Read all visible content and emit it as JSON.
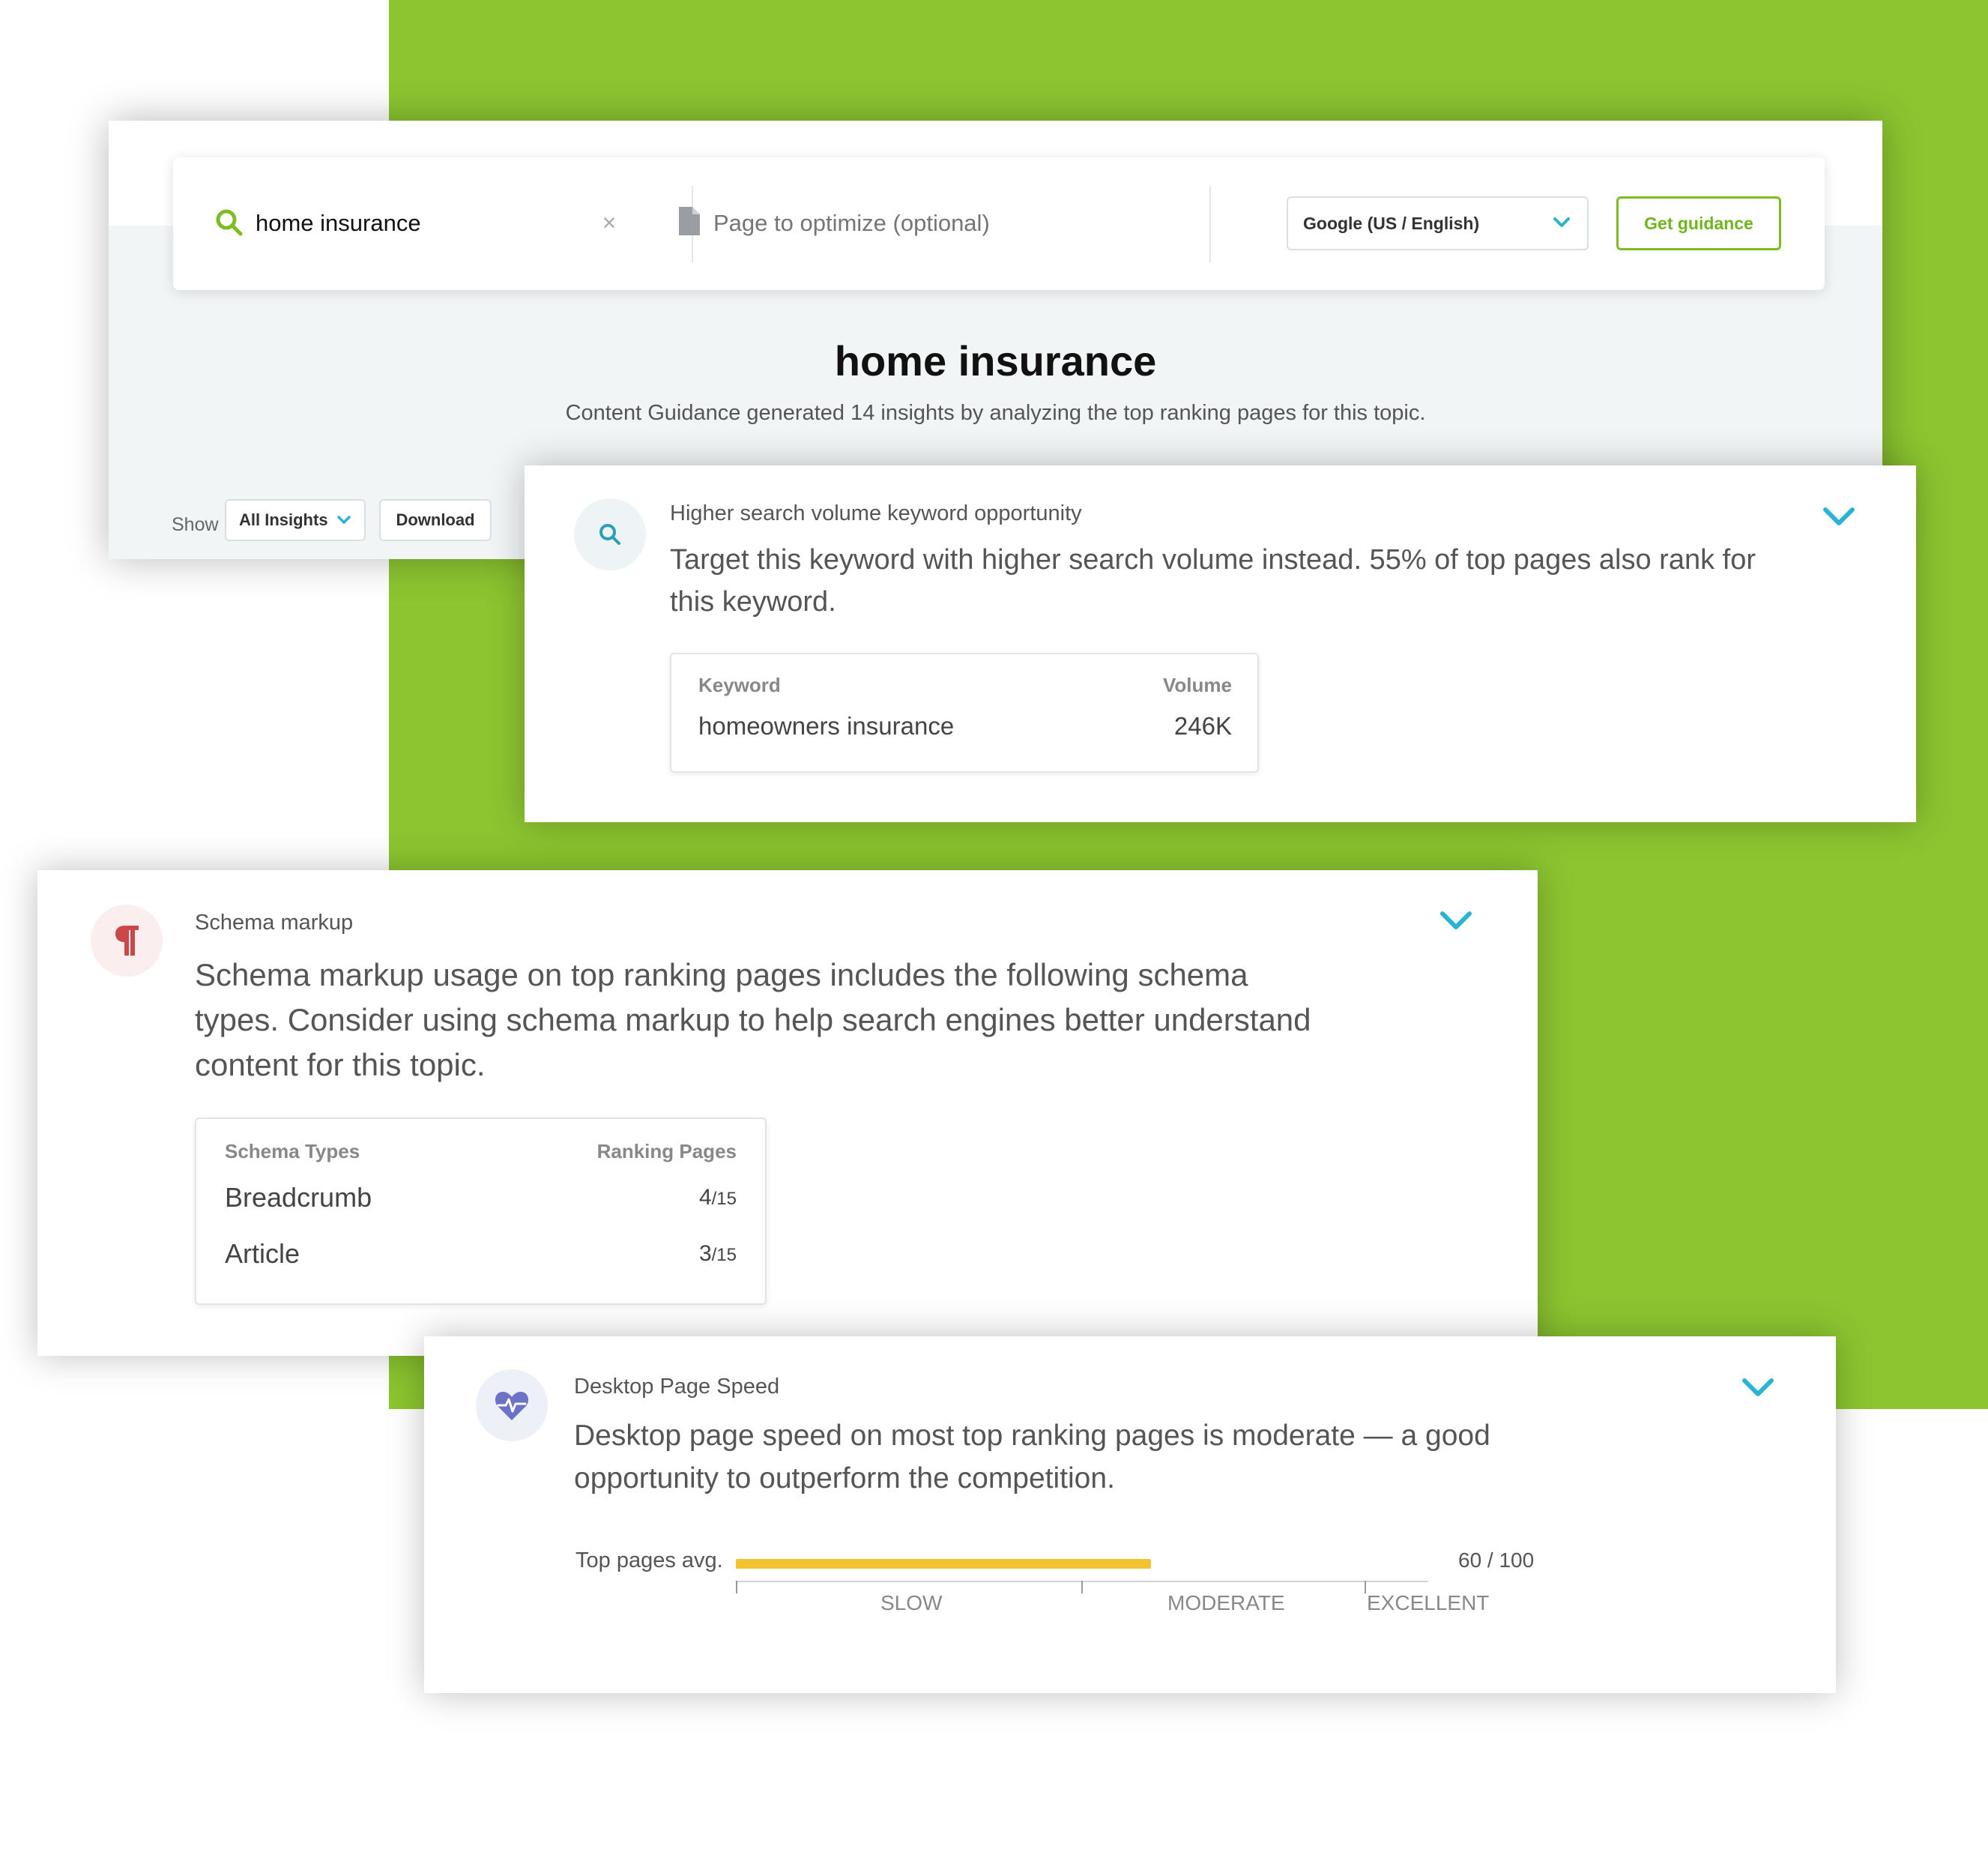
{
  "search": {
    "keyword": "home insurance",
    "page_placeholder": "Page to optimize (optional)",
    "clear_symbol": "×",
    "engine": "Google (US / English)",
    "submit_label": "Get guidance"
  },
  "topic": {
    "title": "home insurance",
    "subtitle": "Content Guidance generated 14 insights by analyzing the top ranking pages for this topic."
  },
  "toolbar": {
    "show_label": "Show",
    "filter_value": "All Insights",
    "download_label": "Download"
  },
  "insights": [
    {
      "category": "Higher search volume keyword opportunity",
      "description_lines": [
        "Target this keyword with higher search volume instead. 55% of top pages also rank for",
        "this keyword."
      ],
      "table": {
        "columns": [
          "Keyword",
          "Volume"
        ],
        "rows": [
          [
            "homeowners insurance",
            "246K"
          ]
        ]
      },
      "icon": "search-icon"
    },
    {
      "category": "Schema markup",
      "description_lines": [
        "Schema markup usage on top ranking pages includes the following schema",
        "types. Consider using schema markup to help search engines better understand",
        "content for this topic."
      ],
      "table": {
        "columns": [
          "Schema Types",
          "Ranking Pages"
        ],
        "rows": [
          {
            "type": "Breadcrumb",
            "count": "4",
            "total": "/15"
          },
          {
            "type": "Article",
            "count": "3",
            "total": "/15"
          }
        ]
      },
      "icon": "paragraph-icon"
    },
    {
      "category": "Desktop Page Speed",
      "description_lines": [
        "Desktop page speed on most top ranking pages is moderate — a good",
        "opportunity to outperform the competition."
      ],
      "speed": {
        "label": "Top pages avg.",
        "score": 60,
        "score_text": "60 / 100",
        "scale": [
          "SLOW",
          "MODERATE",
          "EXCELLENT"
        ]
      },
      "icon": "heartbeat-icon"
    }
  ],
  "colors": {
    "brand_green": "#8cc530",
    "button_green": "#6fb51c",
    "accent_teal": "#2bb3d3",
    "speed_yellow": "#f2c230",
    "schema_red": "#c94848",
    "speed_purple": "#6d72c9"
  }
}
